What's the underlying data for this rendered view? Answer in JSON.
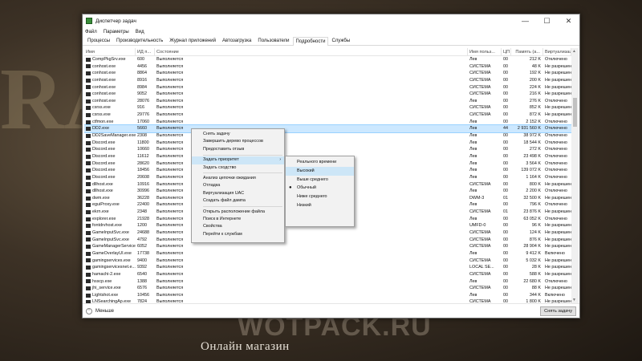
{
  "background": {
    "big_text": "RAC",
    "brand": "WOTPACK.RU",
    "shop": "Онлайн магазин"
  },
  "window": {
    "title": "Диспетчер задач",
    "minimize": "—",
    "maximize": "☐",
    "close": "✕"
  },
  "menu": [
    "Файл",
    "Параметры",
    "Вид"
  ],
  "tabs": [
    "Процессы",
    "Производительность",
    "Журнал приложений",
    "Автозагрузка",
    "Пользователи",
    "Подробности",
    "Службы"
  ],
  "active_tab": "Подробности",
  "columns": [
    "Имя",
    "ИД п...",
    "Состояние",
    "Имя польз...",
    "ЦП",
    "Память (а...",
    "Виртуализация"
  ],
  "rows": [
    [
      "CompPkgSrv.exe",
      "600",
      "Выполняется",
      "Лев",
      "00",
      "212 K",
      "Отключено"
    ],
    [
      "conhost.exe",
      "4456",
      "Выполняется",
      "СИСТЕМА",
      "00",
      "48 K",
      "Не разрешено"
    ],
    [
      "conhost.exe",
      "8864",
      "Выполняется",
      "СИСТЕМА",
      "00",
      "192 K",
      "Не разрешено"
    ],
    [
      "conhost.exe",
      "8916",
      "Выполняется",
      "СИСТЕМА",
      "00",
      "200 K",
      "Не разрешено"
    ],
    [
      "conhost.exe",
      "8984",
      "Выполняется",
      "СИСТЕМА",
      "00",
      "224 K",
      "Не разрешено"
    ],
    [
      "conhost.exe",
      "9052",
      "Выполняется",
      "СИСТЕМА",
      "00",
      "216 K",
      "Не разрешено"
    ],
    [
      "conhost.exe",
      "28076",
      "Выполняется",
      "Лев",
      "00",
      "276 K",
      "Отключено"
    ],
    [
      "csrss.exe",
      "916",
      "Выполняется",
      "СИСТЕМА",
      "00",
      "852 K",
      "Не разрешено"
    ],
    [
      "csrss.exe",
      "29776",
      "Выполняется",
      "СИСТЕМА",
      "00",
      "872 K",
      "Не разрешено"
    ],
    [
      "ctfmon.exe",
      "17060",
      "Выполняется",
      "Лев",
      "00",
      "2 152 K",
      "Отключено"
    ],
    [
      "DD2.exe",
      "5660",
      "Выполняется",
      "Лев",
      "44",
      "2 931 560 K",
      "Отключено"
    ],
    [
      "DD2SaveManager.exe",
      "2308",
      "Выполняется",
      "Лев",
      "00",
      "38 972 K",
      "Отключено"
    ],
    [
      "Discord.exe",
      "11800",
      "Выполняется",
      "Лев",
      "00",
      "18 544 K",
      "Отключено"
    ],
    [
      "Discord.exe",
      "10660",
      "Выполняется",
      "Лев",
      "00",
      "272 K",
      "Отключено"
    ],
    [
      "Discord.exe",
      "11612",
      "Выполняется",
      "Лев",
      "00",
      "23 498 K",
      "Отключено"
    ],
    [
      "Discord.exe",
      "28620",
      "Выполняется",
      "Лев",
      "00",
      "3 564 K",
      "Отключено"
    ],
    [
      "Discord.exe",
      "18456",
      "Выполняется",
      "Лев",
      "00",
      "139 072 K",
      "Отключено"
    ],
    [
      "Discord.exe",
      "20608",
      "Выполняется",
      "Лев",
      "00",
      "1 164 K",
      "Отключено"
    ],
    [
      "dllhost.exe",
      "10916",
      "Выполняется",
      "СИСТЕМА",
      "00",
      "800 K",
      "Не разрешено"
    ],
    [
      "dllhost.exe",
      "30996",
      "Выполняется",
      "Лев",
      "00",
      "2 200 K",
      "Отключено"
    ],
    [
      "dwm.exe",
      "36228",
      "Выполняется",
      "DWM-3",
      "01",
      "32 500 K",
      "Не разрешено"
    ],
    [
      "eguiProxy.exe",
      "22400",
      "Выполняется",
      "Лев",
      "00",
      "796 K",
      "Отключено"
    ],
    [
      "ekrn.exe",
      "2348",
      "Выполняется",
      "СИСТЕМА",
      "01",
      "23 876 K",
      "Не разрешено"
    ],
    [
      "explorer.exe",
      "21928",
      "Выполняется",
      "Лев",
      "00",
      "63 052 K",
      "Отключено"
    ],
    [
      "fontdrvhost.exe",
      "1200",
      "Выполняется",
      "UMFD-0",
      "00",
      "96 K",
      "Не разрешено"
    ],
    [
      "GameInputSvc.exe",
      "24688",
      "Выполняется",
      "СИСТЕМА",
      "00",
      "124 K",
      "Не разрешено"
    ],
    [
      "GameInputSvc.exe",
      "4792",
      "Выполняется",
      "СИСТЕМА",
      "00",
      "876 K",
      "Не разрешено"
    ],
    [
      "GameManagerService...",
      "6052",
      "Выполняется",
      "СИСТЕМА",
      "00",
      "28 904 K",
      "Не разрешено"
    ],
    [
      "GameOverlayUI.exe",
      "17738",
      "Выполняется",
      "Лев",
      "00",
      "9 412 K",
      "Включено"
    ],
    [
      "gamingservices.exe",
      "9400",
      "Выполняется",
      "СИСТЕМА",
      "00",
      "5 032 K",
      "Не разрешено"
    ],
    [
      "gamingservicesnet.e...",
      "9392",
      "Выполняется",
      "LOCAL SE...",
      "00",
      "28 K",
      "Не разрешено"
    ],
    [
      "hamachi-2.exe",
      "6540",
      "Выполняется",
      "СИСТЕМА",
      "00",
      "588 K",
      "Не разрешено"
    ],
    [
      "hsscp.exe",
      "1388",
      "Выполняется",
      "Лев",
      "00",
      "22 680 K",
      "Отключено"
    ],
    [
      "jhi_service.exe",
      "6576",
      "Выполняется",
      "СИСТЕМА",
      "00",
      "88 K",
      "Не разрешено"
    ],
    [
      "Lightshot.exe",
      "10456",
      "Выполняется",
      "Лев",
      "00",
      "344 K",
      "Включено"
    ],
    [
      "LNSearchingAp.exe",
      "7824",
      "Выполняется",
      "СИСТЕМА",
      "00",
      "1 800 K",
      "Не разрешено"
    ]
  ],
  "context_menu": [
    "Снять задачу",
    "Завершить дерево процессов",
    "Предоставить отзыв",
    "",
    "Задать приоритет",
    "Задать сходство",
    "",
    "Анализ цепочки ожидания",
    "Отладка",
    "Виртуализация UAC",
    "Создать файл дампа",
    "",
    "Открыть расположение файла",
    "Поиск в Интернете",
    "Свойства",
    "Перейти к службам"
  ],
  "priority_menu": [
    "Реального времени",
    "Высокий",
    "Выше среднего",
    "Обычный",
    "Ниже среднего",
    "Низкий"
  ],
  "footer": {
    "less": "Меньше",
    "end_task": "Снять задачу"
  }
}
